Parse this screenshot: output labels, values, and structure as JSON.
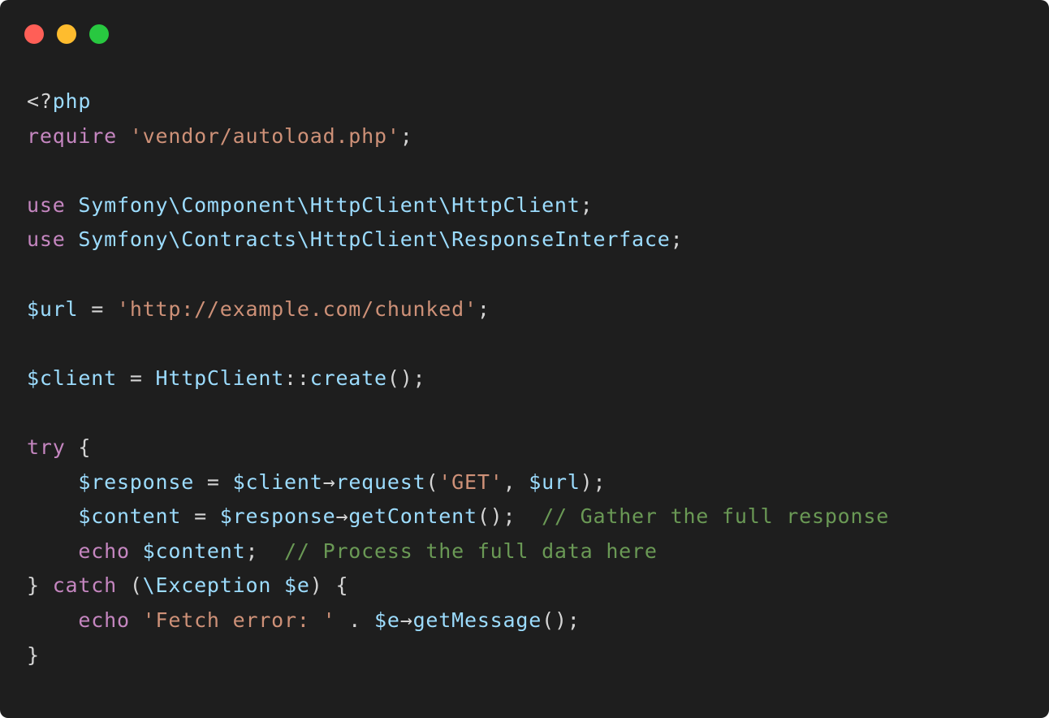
{
  "window": {
    "controls": [
      {
        "name": "close",
        "color": "#ff5f57"
      },
      {
        "name": "minimize",
        "color": "#febc2e"
      },
      {
        "name": "zoom",
        "color": "#28c840"
      }
    ]
  },
  "colors": {
    "background": "#1e1e1e",
    "plain": "#d4d4d4",
    "keyword": "#c586c0",
    "string": "#ce9178",
    "ident": "#9cdcfe",
    "comment": "#6a9955"
  },
  "code": {
    "language": "php",
    "lines": [
      [
        {
          "t": "plain",
          "v": "<?"
        },
        {
          "t": "ident",
          "v": "php"
        }
      ],
      [
        {
          "t": "keyword",
          "v": "require"
        },
        {
          "t": "plain",
          "v": " "
        },
        {
          "t": "string",
          "v": "'vendor/autoload.php'"
        },
        {
          "t": "plain",
          "v": ";"
        }
      ],
      [],
      [
        {
          "t": "keyword",
          "v": "use"
        },
        {
          "t": "plain",
          "v": " "
        },
        {
          "t": "ident",
          "v": "Symfony\\Component\\HttpClient\\HttpClient"
        },
        {
          "t": "plain",
          "v": ";"
        }
      ],
      [
        {
          "t": "keyword",
          "v": "use"
        },
        {
          "t": "plain",
          "v": " "
        },
        {
          "t": "ident",
          "v": "Symfony\\Contracts\\HttpClient\\ResponseInterface"
        },
        {
          "t": "plain",
          "v": ";"
        }
      ],
      [],
      [
        {
          "t": "ident",
          "v": "$url"
        },
        {
          "t": "plain",
          "v": " = "
        },
        {
          "t": "string",
          "v": "'http://example.com/chunked'"
        },
        {
          "t": "plain",
          "v": ";"
        }
      ],
      [],
      [
        {
          "t": "ident",
          "v": "$client"
        },
        {
          "t": "plain",
          "v": " = "
        },
        {
          "t": "ident",
          "v": "HttpClient"
        },
        {
          "t": "plain",
          "v": "::"
        },
        {
          "t": "ident",
          "v": "create"
        },
        {
          "t": "plain",
          "v": "();"
        }
      ],
      [],
      [
        {
          "t": "keyword",
          "v": "try"
        },
        {
          "t": "plain",
          "v": " {"
        }
      ],
      [
        {
          "t": "plain",
          "v": "    "
        },
        {
          "t": "ident",
          "v": "$response"
        },
        {
          "t": "plain",
          "v": " = "
        },
        {
          "t": "ident",
          "v": "$client"
        },
        {
          "t": "plain",
          "v": "→"
        },
        {
          "t": "ident",
          "v": "request"
        },
        {
          "t": "plain",
          "v": "("
        },
        {
          "t": "string",
          "v": "'GET'"
        },
        {
          "t": "plain",
          "v": ", "
        },
        {
          "t": "ident",
          "v": "$url"
        },
        {
          "t": "plain",
          "v": ");"
        }
      ],
      [
        {
          "t": "plain",
          "v": "    "
        },
        {
          "t": "ident",
          "v": "$content"
        },
        {
          "t": "plain",
          "v": " = "
        },
        {
          "t": "ident",
          "v": "$response"
        },
        {
          "t": "plain",
          "v": "→"
        },
        {
          "t": "ident",
          "v": "getContent"
        },
        {
          "t": "plain",
          "v": "();  "
        },
        {
          "t": "comment",
          "v": "// Gather the full response"
        }
      ],
      [
        {
          "t": "plain",
          "v": "    "
        },
        {
          "t": "keyword",
          "v": "echo"
        },
        {
          "t": "plain",
          "v": " "
        },
        {
          "t": "ident",
          "v": "$content"
        },
        {
          "t": "plain",
          "v": ";  "
        },
        {
          "t": "comment",
          "v": "// Process the full data here"
        }
      ],
      [
        {
          "t": "plain",
          "v": "} "
        },
        {
          "t": "keyword",
          "v": "catch"
        },
        {
          "t": "plain",
          "v": " ("
        },
        {
          "t": "ident",
          "v": "\\Exception"
        },
        {
          "t": "plain",
          "v": " "
        },
        {
          "t": "ident",
          "v": "$e"
        },
        {
          "t": "plain",
          "v": ") {"
        }
      ],
      [
        {
          "t": "plain",
          "v": "    "
        },
        {
          "t": "keyword",
          "v": "echo"
        },
        {
          "t": "plain",
          "v": " "
        },
        {
          "t": "string",
          "v": "'Fetch error: '"
        },
        {
          "t": "plain",
          "v": " . "
        },
        {
          "t": "ident",
          "v": "$e"
        },
        {
          "t": "plain",
          "v": "→"
        },
        {
          "t": "ident",
          "v": "getMessage"
        },
        {
          "t": "plain",
          "v": "();"
        }
      ],
      [
        {
          "t": "plain",
          "v": "}"
        }
      ]
    ]
  }
}
